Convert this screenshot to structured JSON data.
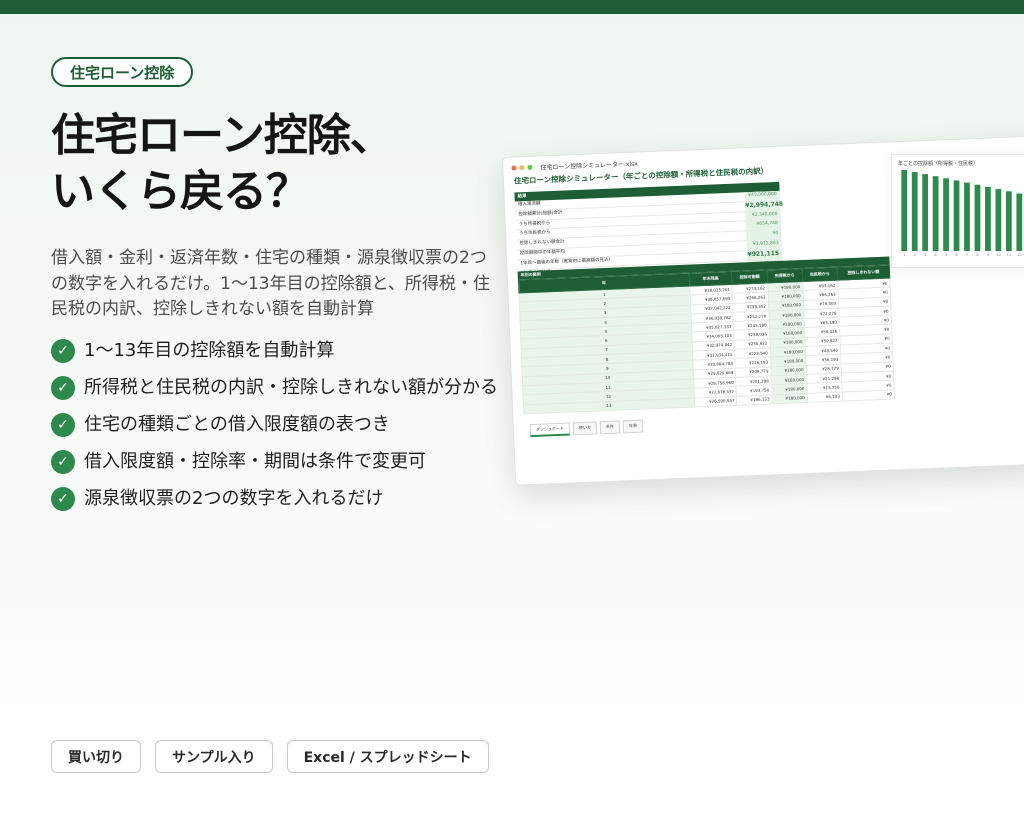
{
  "tag": "住宅ローン控除",
  "title": [
    "住宅ローン控除、",
    "いくら戻る？"
  ],
  "description": "借入額・金利・返済年数・住宅の種類・源泉徴収票の2つの数字を入れるだけ。1〜13年目の控除額と、所得税・住民税の内訳、控除しきれない額を自動計算",
  "features": [
    "1〜13年目の控除額を自動計算",
    "所得税と住民税の内訳・控除しきれない額が分かる",
    "住宅の種類ごとの借入限度額の表つき",
    "借入限度額・控除率・期間は条件で変更可",
    "源泉徴収票の2つの数字を入れるだけ"
  ],
  "check_icon": "check-circle-icon",
  "accent_color": "#1d5e35",
  "pills": [
    "買い切り",
    "サンプル入り",
    "Excel / スプレッドシート"
  ],
  "sheet": {
    "filename": "住宅ローン控除シミュレーター.xlsx",
    "title": "住宅ローン控除シミュレーター（年ごとの控除額・所得税と住民税の内訳）",
    "summary_header": "結果",
    "summary_rows": [
      {
        "label": "借入満済額",
        "value": "¥45,000,000"
      },
      {
        "label": "控除額累計(総額)合計",
        "value": "¥2,994,748"
      },
      {
        "label": "うち所得税から",
        "value": "¥2,340,000"
      },
      {
        "label": "うち住民税から",
        "value": "¥654,748"
      },
      {
        "label": "控除しきれない額合計",
        "value": "¥0"
      },
      {
        "label": "控除期間中の年額平均",
        "value": "¥1,912,863"
      },
      {
        "label": "1年目〜最後の年数（実質的に最高額の見込）",
        "value": "¥921,115"
      },
      {
        "label": "1年目の控除額",
        "value": "¥273,162"
      }
    ],
    "table_header": "年別の案例",
    "columns": [
      "年",
      "年末残高",
      "控除可能額",
      "所得税から",
      "住民税から",
      "控除しきれない額"
    ],
    "rows": [
      [
        "1",
        "¥38,025,261",
        "¥273,162",
        "¥180,000",
        "¥93,162",
        "¥0"
      ],
      [
        "2",
        "¥38,057,695",
        "¥266,263",
        "¥180,000",
        "¥86,263",
        "¥0"
      ],
      [
        "3",
        "¥37,042,222",
        "¥259,302",
        "¥180,000",
        "¥79,300",
        "¥0"
      ],
      [
        "4",
        "¥36,039,782",
        "¥252,278",
        "¥180,000",
        "¥72,278",
        "¥0"
      ],
      [
        "5",
        "¥35,027,333",
        "¥245,190",
        "¥180,000",
        "¥65,190",
        "¥0"
      ],
      [
        "6",
        "¥34,005,104",
        "¥238,036",
        "¥180,000",
        "¥58,036",
        "¥0"
      ],
      [
        "7",
        "¥32,974,842",
        "¥230,822",
        "¥180,000",
        "¥50,822",
        "¥0"
      ],
      [
        "8",
        "¥31,934,415",
        "¥223,540",
        "¥180,000",
        "¥43,540",
        "¥0"
      ],
      [
        "9",
        "¥30,884,784",
        "¥216,193",
        "¥180,000",
        "¥36,193",
        "¥0"
      ],
      [
        "10",
        "¥29,825,669",
        "¥208,779",
        "¥180,000",
        "¥28,779",
        "¥0"
      ],
      [
        "11",
        "¥28,756,960",
        "¥201,298",
        "¥180,000",
        "¥21,298",
        "¥0"
      ],
      [
        "12",
        "¥27,678,537",
        "¥193,750",
        "¥180,000",
        "¥13,750",
        "¥0"
      ],
      [
        "13",
        "¥26,590,547",
        "¥186,133",
        "¥180,000",
        "¥6,133",
        "¥0"
      ]
    ],
    "tabs": [
      "ダッシュボード",
      "使い方",
      "条件",
      "年表"
    ]
  },
  "chart_data": {
    "type": "bar",
    "title": "年ごとの控除額（所得税・住民税）",
    "categories": [
      "1",
      "2",
      "3",
      "4",
      "5",
      "6",
      "7",
      "8",
      "9",
      "10",
      "11",
      "12",
      "13"
    ],
    "values": [
      273162,
      266263,
      259302,
      252278,
      245190,
      238036,
      230822,
      223540,
      216193,
      208779,
      201298,
      193750,
      186133
    ],
    "color": "#2e8a4c"
  }
}
